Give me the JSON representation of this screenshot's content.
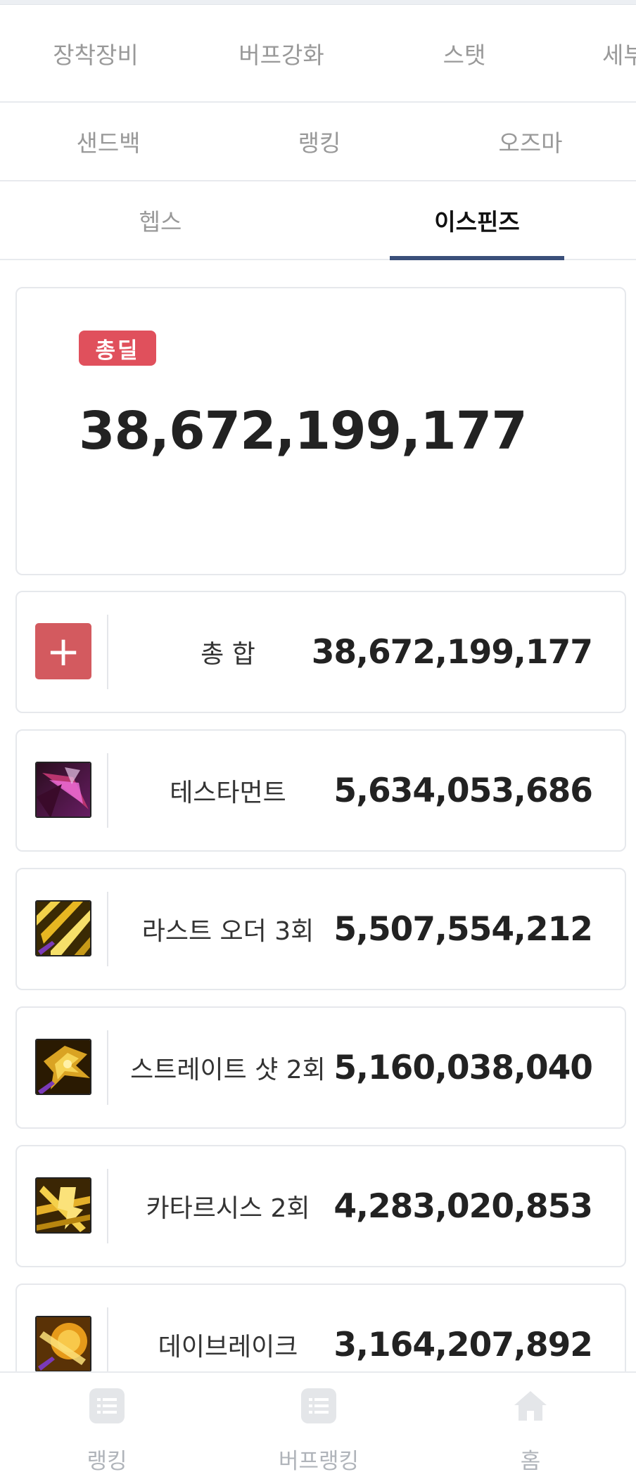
{
  "tabs_row1": [
    "장착장비",
    "버프강화",
    "스탯",
    "세부"
  ],
  "tabs_row2": [
    "샌드백",
    "랭킹",
    "오즈마"
  ],
  "tabs_row3": [
    "헵스",
    "이스핀즈"
  ],
  "active_tab": "이스핀즈",
  "summary": {
    "badge": "총딜",
    "value": "38,672,199,177"
  },
  "skills": [
    {
      "name": "총 합",
      "value": "38,672,199,177",
      "icon": "plus-icon"
    },
    {
      "name": "테스타먼트",
      "value": "5,634,053,686",
      "icon": "testament-skill-icon"
    },
    {
      "name": "라스트 오더 3회",
      "value": "5,507,554,212",
      "icon": "last-order-skill-icon"
    },
    {
      "name": "스트레이트 샷 2회",
      "value": "5,160,038,040",
      "icon": "straight-shot-skill-icon"
    },
    {
      "name": "카타르시스 2회",
      "value": "4,283,020,853",
      "icon": "catharsis-skill-icon"
    },
    {
      "name": "데이브레이크",
      "value": "3,164,207,892",
      "icon": "daybreak-skill-icon"
    }
  ],
  "bottom_nav": [
    {
      "label": "랭킹",
      "icon": "list-icon"
    },
    {
      "label": "버프랭킹",
      "icon": "list-icon"
    },
    {
      "label": "홈",
      "icon": "home-icon"
    }
  ],
  "colors": {
    "accent": "#3a4f7a",
    "badge": "#e0505c",
    "plus_box": "#d35a5f"
  }
}
